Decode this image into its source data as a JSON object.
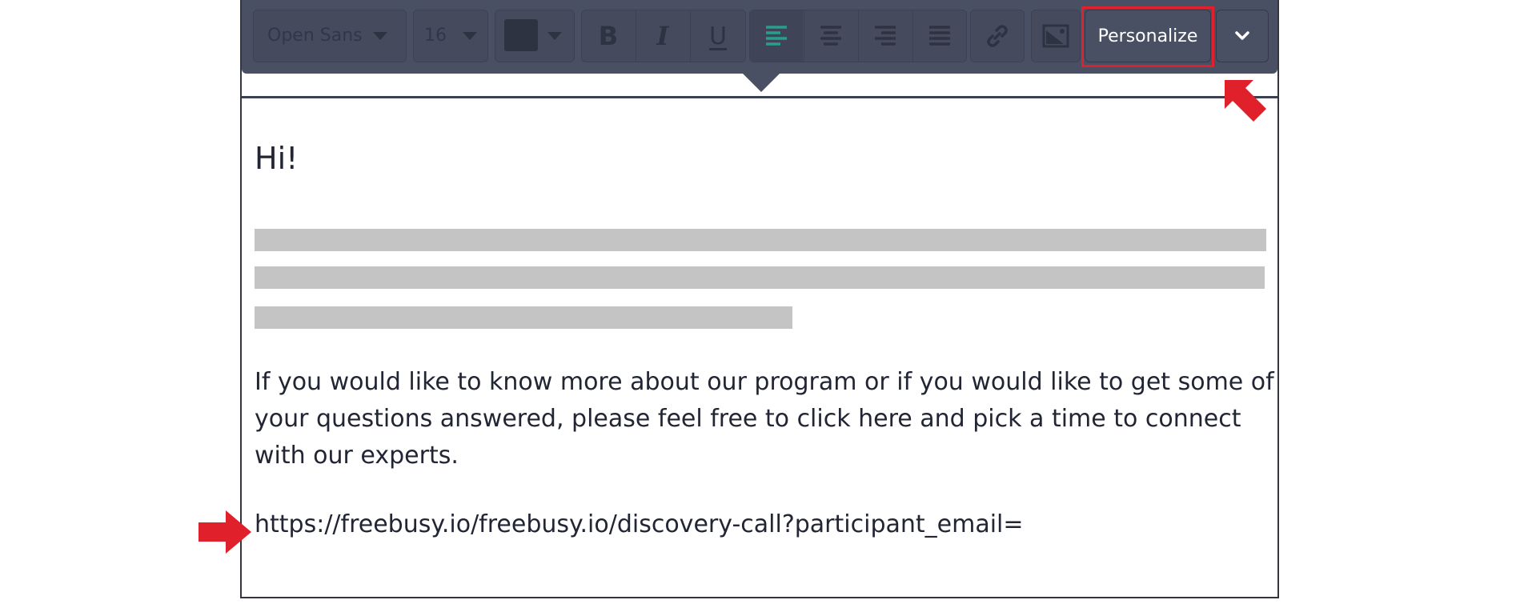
{
  "toolbar": {
    "font_family_value": "Open Sans",
    "font_size_value": "16",
    "text_color": "#2e3342",
    "bold_label": "B",
    "italic_label": "I",
    "underline_label": "U",
    "personalize_label": "Personalize",
    "active_align_color": "#2a9d8f",
    "icons": [
      "bold-icon",
      "italic-icon",
      "underline-icon",
      "align-left-icon",
      "align-center-icon",
      "align-right-icon",
      "align-justify-icon",
      "link-icon",
      "image-icon",
      "chevron-down-icon"
    ]
  },
  "content": {
    "greeting": "Hi!",
    "paragraph": "If you would like to know more about our program or if you would like to get some of your questions answered, please feel free to click here and pick a time to connect with our experts.",
    "url": "https://freebusy.io/freebusy.io/discovery-call?participant_email="
  },
  "annotations": {
    "highlight_color": "#e0212b"
  }
}
